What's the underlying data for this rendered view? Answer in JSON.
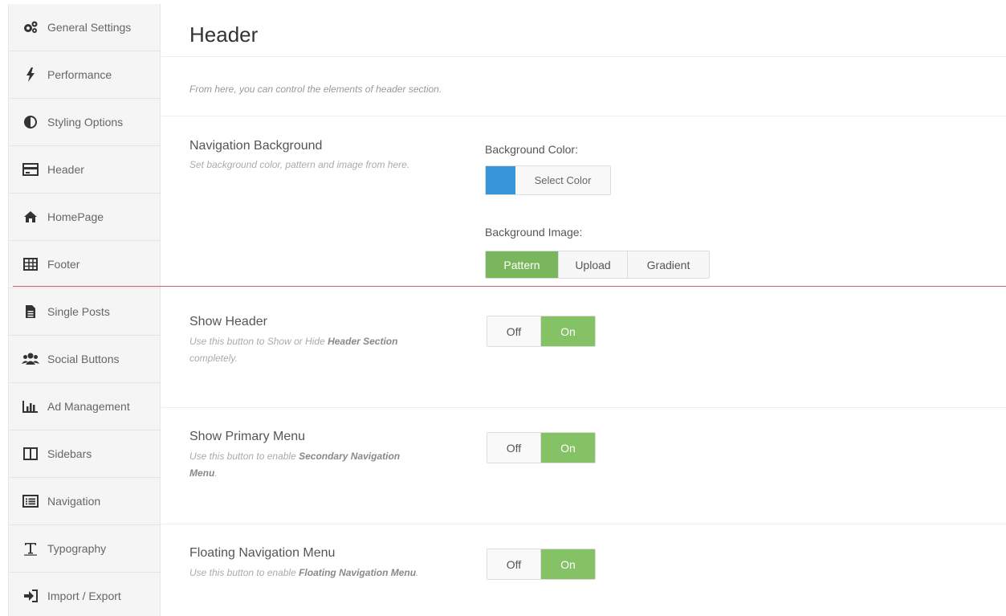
{
  "sidebar": {
    "items": [
      {
        "label": "General Settings",
        "icon": "gears-icon"
      },
      {
        "label": "Performance",
        "icon": "bolt-icon"
      },
      {
        "label": "Styling Options",
        "icon": "contrast-icon"
      },
      {
        "label": "Header",
        "icon": "header-layout-icon"
      },
      {
        "label": "HomePage",
        "icon": "home-icon"
      },
      {
        "label": "Footer",
        "icon": "table-icon"
      },
      {
        "label": "Single Posts",
        "icon": "file-icon"
      },
      {
        "label": "Social Buttons",
        "icon": "users-icon"
      },
      {
        "label": "Ad Management",
        "icon": "bar-chart-icon"
      },
      {
        "label": "Sidebars",
        "icon": "columns-icon"
      },
      {
        "label": "Navigation",
        "icon": "list-icon"
      },
      {
        "label": "Typography",
        "icon": "text-icon"
      },
      {
        "label": "Import / Export",
        "icon": "sign-in-icon"
      }
    ]
  },
  "main": {
    "title": "Header",
    "intro": "From here, you can control the elements of header section.",
    "nav_background": {
      "title": "Navigation Background",
      "description": "Set background color, pattern and image from here.",
      "bg_color_label": "Background Color:",
      "select_color": "Select Color",
      "swatch_color": "#3896d8",
      "bg_image_label": "Background Image:",
      "image_options": [
        "Pattern",
        "Upload",
        "Gradient"
      ],
      "selected_option": "Pattern"
    },
    "show_header": {
      "title": "Show Header",
      "desc_prefix": "Use this button to Show or Hide ",
      "desc_bold": "Header Section",
      "desc_suffix": " completely.",
      "off": "Off",
      "on": "On"
    },
    "show_primary_menu": {
      "title": "Show Primary Menu",
      "desc_prefix": "Use this button to enable ",
      "desc_bold": "Secondary Navigation Menu",
      "desc_suffix": ".",
      "off": "Off",
      "on": "On"
    },
    "floating_nav": {
      "title": "Floating Navigation Menu",
      "desc_prefix": "Use this button to enable ",
      "desc_bold": "Floating Navigation Menu",
      "desc_suffix": ".",
      "off": "Off",
      "on": "On"
    }
  },
  "colors": {
    "active_green": "#7ab75c",
    "toggle_on": "#85c165",
    "accent_line": "#c8636b"
  }
}
